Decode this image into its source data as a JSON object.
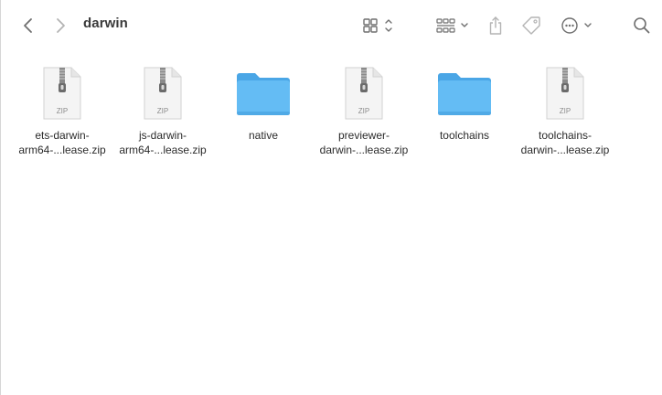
{
  "window": {
    "title": "darwin"
  },
  "toolbar": {
    "back_icon": "chevron-left-icon",
    "forward_icon": "chevron-right-icon",
    "view_icon": "grid-view-icon",
    "group_icon": "group-by-icon",
    "share_icon": "share-icon",
    "tag_icon": "tag-icon",
    "more_icon": "ellipsis-circle-icon",
    "search_icon": "search-icon"
  },
  "files": [
    {
      "type": "zip",
      "icon": "zip-file-icon",
      "badge": "ZIP",
      "name_line1": "ets-darwin-",
      "name_line2": "arm64-...lease.zip"
    },
    {
      "type": "zip",
      "icon": "zip-file-icon",
      "badge": "ZIP",
      "name_line1": "js-darwin-",
      "name_line2": "arm64-...lease.zip"
    },
    {
      "type": "folder",
      "icon": "folder-icon",
      "badge": "",
      "name_line1": "native",
      "name_line2": ""
    },
    {
      "type": "zip",
      "icon": "zip-file-icon",
      "badge": "ZIP",
      "name_line1": "previewer-",
      "name_line2": "darwin-...lease.zip"
    },
    {
      "type": "folder",
      "icon": "folder-icon",
      "badge": "",
      "name_line1": "toolchains",
      "name_line2": ""
    },
    {
      "type": "zip",
      "icon": "zip-file-icon",
      "badge": "ZIP",
      "name_line1": "toolchains-",
      "name_line2": "darwin-...lease.zip"
    }
  ],
  "colors": {
    "folder": "#5ab4f0",
    "folder_tab": "#4aa6e6",
    "toolbar_icon": "#6f6f6f",
    "toolbar_icon_disabled": "#b4b4b4"
  }
}
